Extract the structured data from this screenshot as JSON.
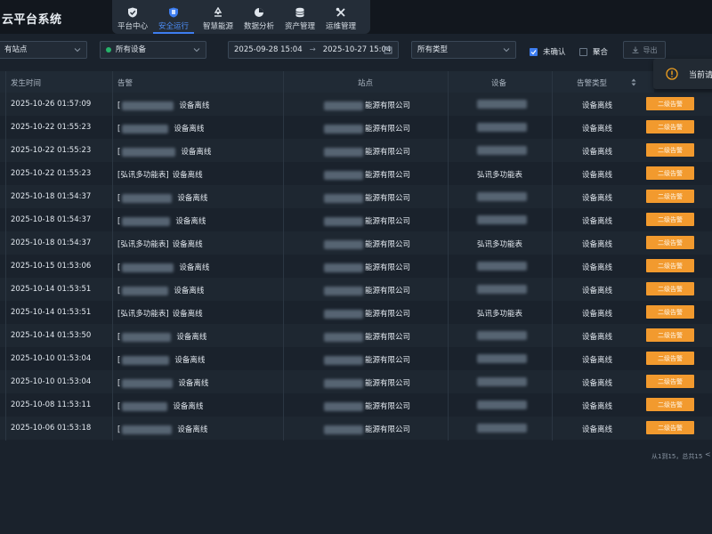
{
  "app": {
    "title": "云平台系统"
  },
  "nav": [
    {
      "label": "平台中心",
      "icon": "shield-check-icon"
    },
    {
      "label": "安全运行",
      "icon": "shield-flag-icon",
      "active": true
    },
    {
      "label": "智慧能源",
      "icon": "recycle-icon"
    },
    {
      "label": "数据分析",
      "icon": "pie-chart-icon"
    },
    {
      "label": "资产管理",
      "icon": "database-icon"
    },
    {
      "label": "运维管理",
      "icon": "tools-icon"
    }
  ],
  "filters": {
    "site": "有站点",
    "device": "所有设备",
    "date_start": "2025-09-28 15:04",
    "date_arrow": "→",
    "date_end": "2025-10-27 15:04",
    "type": "所有类型",
    "unconfirmed": "未确认",
    "merge": "聚合",
    "export": "导出"
  },
  "notification": {
    "text": "当前请"
  },
  "table": {
    "columns": [
      "发生时间",
      "告警",
      "站点",
      "设备",
      "告警类型"
    ],
    "rows": [
      {
        "time": "2025-10-26 01:57:09",
        "alarm_prefix": "[",
        "alarm_device": "",
        "alarm": "设备离线",
        "site": "能源有限公司",
        "device": "",
        "type": "设备离线",
        "level": "二级告警"
      },
      {
        "time": "2025-10-22 01:55:23",
        "alarm_prefix": "[",
        "alarm_device": "",
        "alarm": "设备离线",
        "site": "能源有限公司",
        "device": "",
        "type": "设备离线",
        "level": "二级告警"
      },
      {
        "time": "2025-10-22 01:55:23",
        "alarm_prefix": "[",
        "alarm_device": "",
        "alarm": "设备离线",
        "site": "能源有限公司",
        "device": "",
        "type": "设备离线",
        "level": "二级告警"
      },
      {
        "time": "2025-10-22 01:55:23",
        "alarm_prefix": "",
        "alarm_device": "[弘讯多功能表]",
        "alarm": "设备离线",
        "site": "能源有限公司",
        "device": "弘讯多功能表",
        "type": "设备离线",
        "level": "二级告警"
      },
      {
        "time": "2025-10-18 01:54:37",
        "alarm_prefix": "[",
        "alarm_device": "",
        "alarm": "设备离线",
        "site": "能源有限公司",
        "device": "",
        "type": "设备离线",
        "level": "二级告警"
      },
      {
        "time": "2025-10-18 01:54:37",
        "alarm_prefix": "[",
        "alarm_device": "",
        "alarm": "设备离线",
        "site": "能源有限公司",
        "device": "",
        "type": "设备离线",
        "level": "二级告警"
      },
      {
        "time": "2025-10-18 01:54:37",
        "alarm_prefix": "",
        "alarm_device": "[弘讯多功能表]",
        "alarm": "设备离线",
        "site": "能源有限公司",
        "device": "弘讯多功能表",
        "type": "设备离线",
        "level": "二级告警"
      },
      {
        "time": "2025-10-15 01:53:06",
        "alarm_prefix": "[",
        "alarm_device": "",
        "alarm": "设备离线",
        "site": "能源有限公司",
        "device": "",
        "type": "设备离线",
        "level": "二级告警"
      },
      {
        "time": "2025-10-14 01:53:51",
        "alarm_prefix": "[",
        "alarm_device": "",
        "alarm": "设备离线",
        "site": "能源有限公司",
        "device": "",
        "type": "设备离线",
        "level": "二级告警"
      },
      {
        "time": "2025-10-14 01:53:51",
        "alarm_prefix": "",
        "alarm_device": "[弘讯多功能表]",
        "alarm": "设备离线",
        "site": "能源有限公司",
        "device": "弘讯多功能表",
        "type": "设备离线",
        "level": "二级告警"
      },
      {
        "time": "2025-10-14 01:53:50",
        "alarm_prefix": "[",
        "alarm_device": "",
        "alarm": "设备离线",
        "site": "能源有限公司",
        "device": "",
        "type": "设备离线",
        "level": "二级告警"
      },
      {
        "time": "2025-10-10 01:53:04",
        "alarm_prefix": "[",
        "alarm_device": "",
        "alarm": "设备离线",
        "site": "能源有限公司",
        "device": "",
        "type": "设备离线",
        "level": "二级告警"
      },
      {
        "time": "2025-10-10 01:53:04",
        "alarm_prefix": "[",
        "alarm_device": "",
        "alarm": "设备离线",
        "site": "能源有限公司",
        "device": "",
        "type": "设备离线",
        "level": "二级告警"
      },
      {
        "time": "2025-10-08 11:53:11",
        "alarm_prefix": "[",
        "alarm_device": "",
        "alarm": "设备离线",
        "site": "能源有限公司",
        "device": "",
        "type": "设备离线",
        "level": "二级告警"
      },
      {
        "time": "2025-10-06 01:53:18",
        "alarm_prefix": "[",
        "alarm_device": "",
        "alarm": "设备离线",
        "site": "能源有限公司",
        "device": "",
        "type": "设备离线",
        "level": "二级告警"
      }
    ]
  },
  "pager": {
    "text": "从1到15，总共15",
    "prev": "<"
  },
  "colors": {
    "accent": "#3d7df0",
    "level_badge": "#f29a2e",
    "online_dot": "#26b36a"
  }
}
